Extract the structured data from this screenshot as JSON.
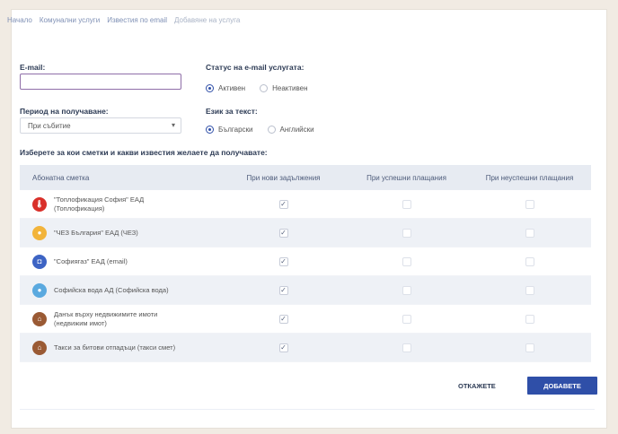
{
  "breadcrumb": [
    "Начало",
    "Комунални услуги",
    "Известия по email",
    "Добавяне на услуга"
  ],
  "form": {
    "email_label": "E-mail:",
    "email_value": "",
    "status_label": "Статус на e-mail услугата:",
    "status_options": [
      "Активен",
      "Неактивен"
    ],
    "period_label": "Период на получаване:",
    "period_value": "При събитие",
    "lang_label": "Език за текст:",
    "lang_options": [
      "Български",
      "Английски"
    ]
  },
  "section_title": "Изберете за кои сметки и какви известия желаете да получавате:",
  "table": {
    "headers": [
      "Абонатна сметка",
      "При нови задължения",
      "При успешни плащания",
      "При неуспешни плащания"
    ],
    "rows": [
      {
        "name": "\"Топлофикация София\" ЕАД (Топлофикация)",
        "icon": "toplofikacia-icon",
        "color": "#d9302a",
        "glyph": "🌡",
        "c1": true,
        "c2": false,
        "c3": false
      },
      {
        "name": "\"ЧЕЗ България\" ЕАД (ЧЕЗ)",
        "icon": "bulb-icon",
        "color": "#f2b43b",
        "glyph": "●",
        "c1": true,
        "c2": false,
        "c3": false
      },
      {
        "name": "\"Софиягаз\" ЕАД (email)",
        "icon": "gas-icon",
        "color": "#3d64c4",
        "glyph": "◘",
        "c1": true,
        "c2": false,
        "c3": false
      },
      {
        "name": "Софийска вода АД (Софийска вода)",
        "icon": "water-drop-icon",
        "color": "#5aa9df",
        "glyph": "●",
        "c1": true,
        "c2": false,
        "c3": false
      },
      {
        "name": "Данък върху недвижимите имоти (недвижим имот)",
        "icon": "house-tax-icon",
        "color": "#9a5a34",
        "glyph": "⌂",
        "c1": true,
        "c2": false,
        "c3": false
      },
      {
        "name": "Такси за битови отпадъци (такси смет)",
        "icon": "waste-fee-icon",
        "color": "#9a5a34",
        "glyph": "⌂",
        "c1": true,
        "c2": false,
        "c3": false
      }
    ]
  },
  "buttons": {
    "cancel": "ОТКАЖЕТЕ",
    "add": "ДОБАВЕТЕ"
  },
  "colors": {
    "accent": "#2f4fa8",
    "input_border": "#8f6ea8",
    "header_bg": "#e7ebf2"
  }
}
